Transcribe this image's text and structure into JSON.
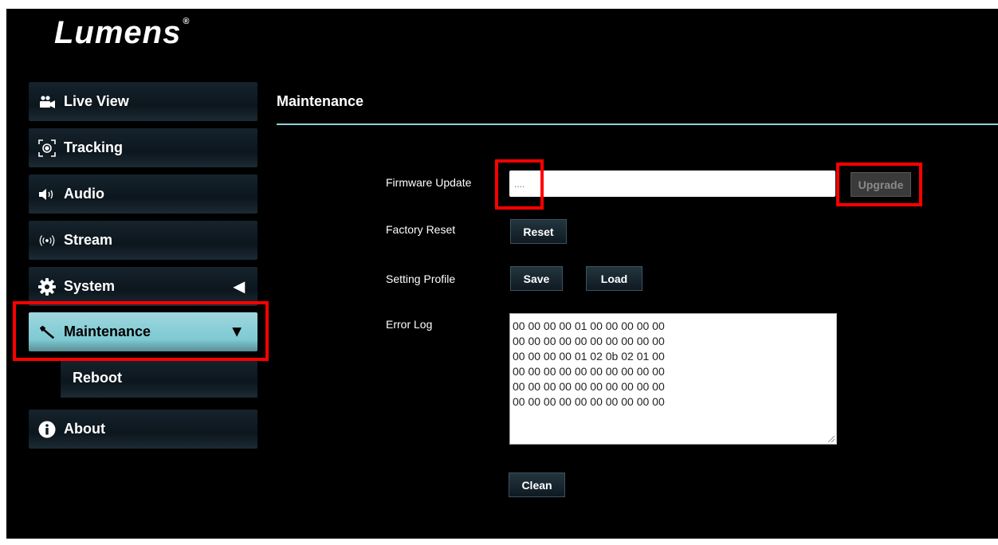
{
  "brand": {
    "name": "Lumens",
    "mark": "®"
  },
  "sidebar": {
    "items": [
      {
        "label": "Live View",
        "icon": "camera-icon"
      },
      {
        "label": "Tracking",
        "icon": "tracking-icon"
      },
      {
        "label": "Audio",
        "icon": "speaker-icon"
      },
      {
        "label": "Stream",
        "icon": "stream-icon"
      },
      {
        "label": "System",
        "icon": "gear-icon",
        "arrow": "◀"
      },
      {
        "label": "Maintenance",
        "icon": "wrench-icon",
        "arrow": "▼",
        "active": true
      },
      {
        "label": "About",
        "icon": "info-icon"
      }
    ],
    "sub_items": [
      {
        "label": "Reboot"
      }
    ]
  },
  "main": {
    "title": "Maintenance",
    "firmware": {
      "label": "Firmware Update",
      "value": "....",
      "button": "Upgrade",
      "button_disabled": true
    },
    "factory_reset": {
      "label": "Factory Reset",
      "button": "Reset"
    },
    "setting_profile": {
      "label": "Setting Profile",
      "save": "Save",
      "load": "Load"
    },
    "error_log": {
      "label": "Error Log",
      "lines": [
        "00 00 00 00 01 00 00 00 00 00",
        "00 00 00 00 00 00 00 00 00 00",
        "00 00 00 00 01 02 0b 02 01 00",
        "00 00 00 00 00 00 00 00 00 00",
        "00 00 00 00 00 00 00 00 00 00",
        "00 00 00 00 00 00 00 00 00 00"
      ],
      "clean": "Clean"
    }
  },
  "colors": {
    "accent": "#8fd3da",
    "active_nav": "#7ecad3",
    "highlight": "#ff0000",
    "background": "#000000"
  }
}
